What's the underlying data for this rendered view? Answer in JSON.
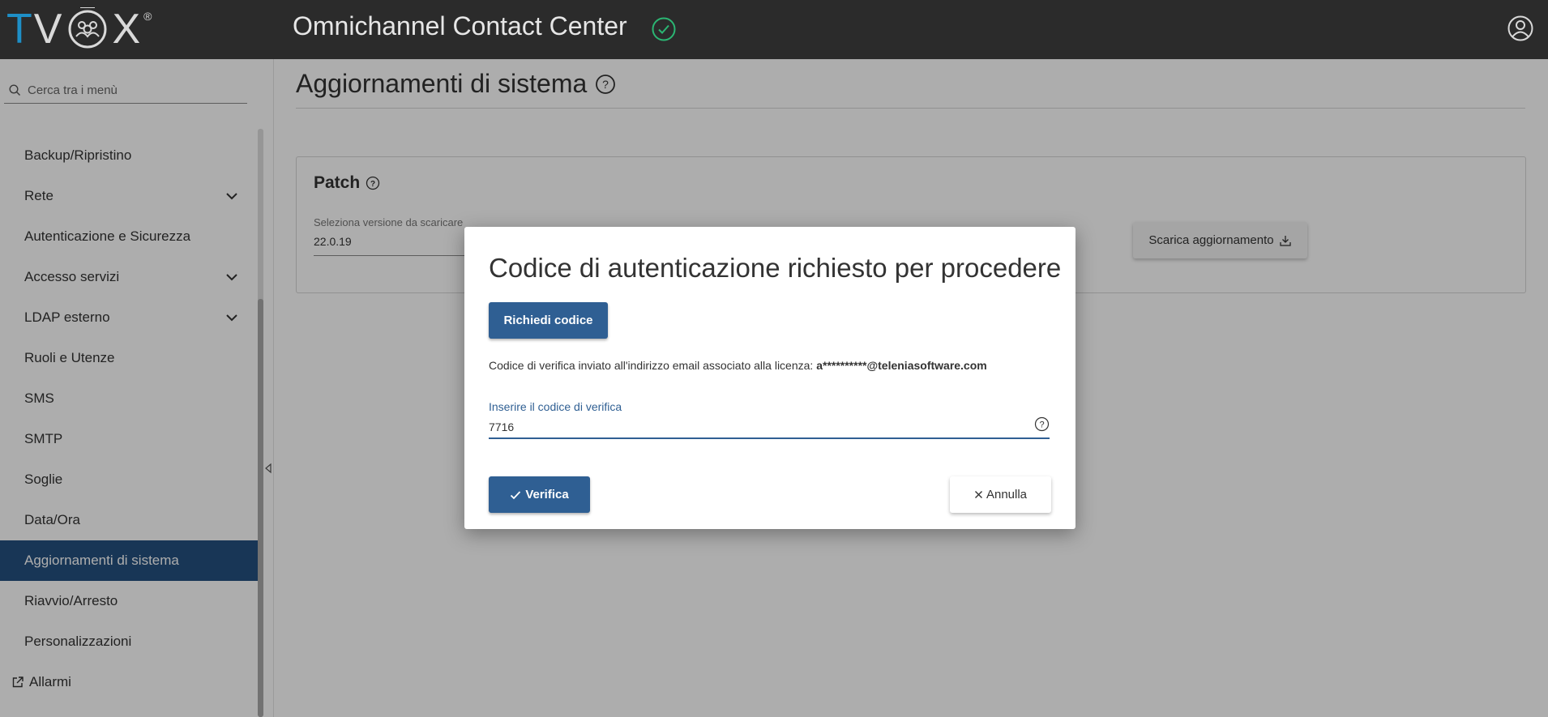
{
  "header": {
    "logo_text": {
      "t": "T",
      "v": "V",
      "x": "X",
      "reg": "®"
    },
    "app_title": "Omnichannel Contact Center",
    "status_icon": "check-circle-icon",
    "user_icon": "user-account-icon"
  },
  "sidebar": {
    "search_placeholder": "Cerca tra i menù",
    "items": [
      {
        "label": "Backup/Ripristino",
        "expandable": false
      },
      {
        "label": "Rete",
        "expandable": true
      },
      {
        "label": "Autenticazione e Sicurezza",
        "expandable": false
      },
      {
        "label": "Accesso servizi",
        "expandable": true
      },
      {
        "label": "LDAP esterno",
        "expandable": true
      },
      {
        "label": "Ruoli e Utenze",
        "expandable": false
      },
      {
        "label": "SMS",
        "expandable": false
      },
      {
        "label": "SMTP",
        "expandable": false
      },
      {
        "label": "Soglie",
        "expandable": false
      },
      {
        "label": "Data/Ora",
        "expandable": false
      },
      {
        "label": "Aggiornamenti di sistema",
        "expandable": false,
        "active": true
      },
      {
        "label": "Riavvio/Arresto",
        "expandable": false
      },
      {
        "label": "Personalizzazioni",
        "expandable": false
      },
      {
        "label": "Allarmi",
        "expandable": false,
        "external": true
      }
    ]
  },
  "main": {
    "page_title": "Aggiornamenti di sistema",
    "patch": {
      "title": "Patch",
      "version_label": "Seleziona versione da scaricare",
      "version_value": "22.0.19",
      "download_label": "Scarica aggiornamento"
    }
  },
  "dialog": {
    "title": "Codice di autenticazione richiesto per procedere",
    "request_code_label": "Richiedi codice",
    "info_prefix": "Codice di verifica inviato all'indirizzo email associato alla licenza: ",
    "info_email": "a**********@teleniasoftware.com",
    "code_label": "Inserire il codice di verifica",
    "code_value": "7716",
    "verify_label": "Verifica",
    "cancel_label": "Annulla"
  },
  "colors": {
    "header_bg": "#2b2b2b",
    "accent": "#2f5f93",
    "active_menu": "#24507f",
    "logo_blue": "#1e8fc7",
    "ok_green": "#2bb673"
  }
}
